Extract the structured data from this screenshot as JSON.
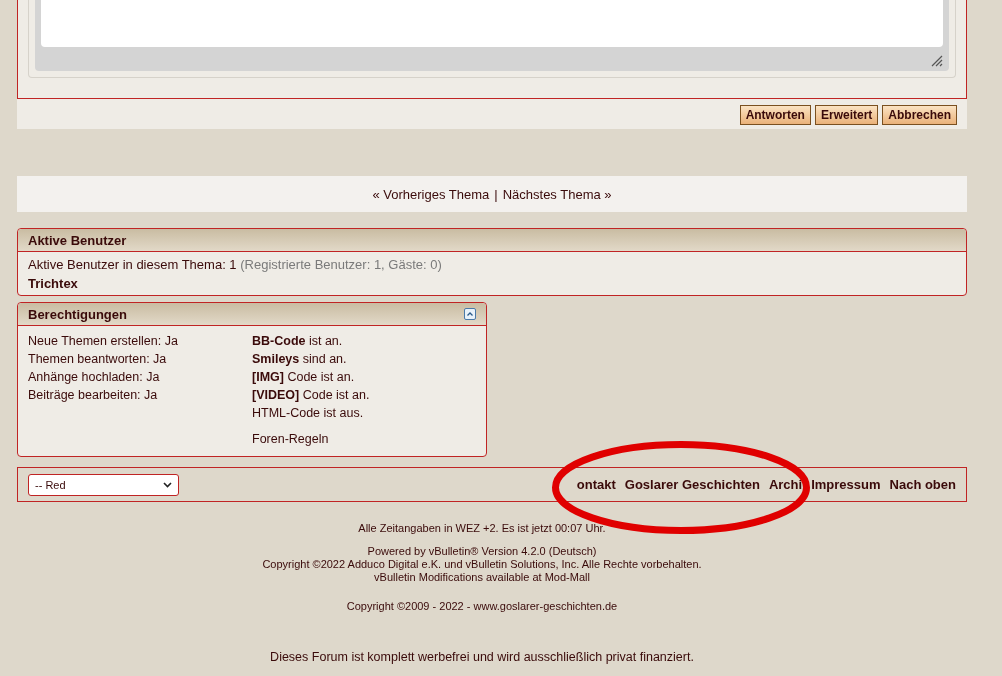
{
  "editor": {
    "buttons": [
      "Antworten",
      "Erweitert",
      "Abbrechen"
    ]
  },
  "thread_nav": {
    "previous": "« Vorheriges Thema",
    "separator": "|",
    "next": "Nächstes Thema »"
  },
  "active_users": {
    "title": "Aktive Benutzer",
    "summary": "Aktive Benutzer in diesem Thema: 1",
    "detail": "(Registrierte Benutzer: 1, Gäste: 0)",
    "users": [
      "Trichtex"
    ]
  },
  "permissions": {
    "title": "Berechtigungen",
    "left": [
      "Neue Themen erstellen: Ja",
      "Themen beantworten: Ja",
      "Anhänge hochladen: Ja",
      "Beiträge bearbeiten: Ja"
    ],
    "right": [
      "**BB-Code** ist an.",
      "**Smileys** sind an.",
      "**[IMG]** Code ist an.",
      "**[VIDEO]** Code ist an.",
      "HTML-Code ist aus."
    ],
    "rules_link": "Foren-Regeln"
  },
  "footer_bar": {
    "style_select": "-- Red",
    "links": [
      "ontakt",
      "Goslarer Geschichten",
      "Archi",
      "Impressum",
      "Nach oben"
    ]
  },
  "footer_text": {
    "timezone": "Alle Zeitangaben in WEZ +2. Es ist jetzt 00:07 Uhr.",
    "powered": "Powered by vBulletin® Version 4.2.0 (Deutsch)",
    "copyright": "Copyright ©2022 Adduco Digital e.K. und vBulletin Solutions, Inc. Alle Rechte vorbehalten.",
    "modifications": "vBulletin Modifications available at Mod-Mall",
    "site_copyright": "Copyright ©2009 - 2022 - ",
    "site_link": "www.goslarer-geschichten.de",
    "notice": "Dieses Forum ist komplett werbefrei und wird ausschließlich privat finanziert."
  }
}
